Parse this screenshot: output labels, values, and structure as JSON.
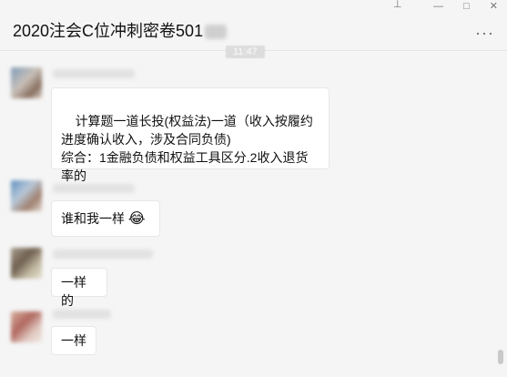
{
  "window": {
    "title": "2020注会C位冲刺密卷501",
    "controls": {
      "pin": "⊥",
      "minimize": "—",
      "maximize": "□",
      "close": "✕"
    },
    "more": "···"
  },
  "chat": {
    "timestamp": "11:47",
    "messages": [
      {
        "text": "计算题一道长投(权益法)一道（收入按履约进度确认收入，涉及合同负债)\n综合：1金融负债和权益工具区分.2收入退货率的"
      },
      {
        "text": "谁和我一样",
        "emoji": "😂"
      },
      {
        "text": "一样的"
      },
      {
        "text": "一样"
      }
    ]
  },
  "colors": {
    "background": "#f5f5f5",
    "bubble": "#ffffff"
  }
}
